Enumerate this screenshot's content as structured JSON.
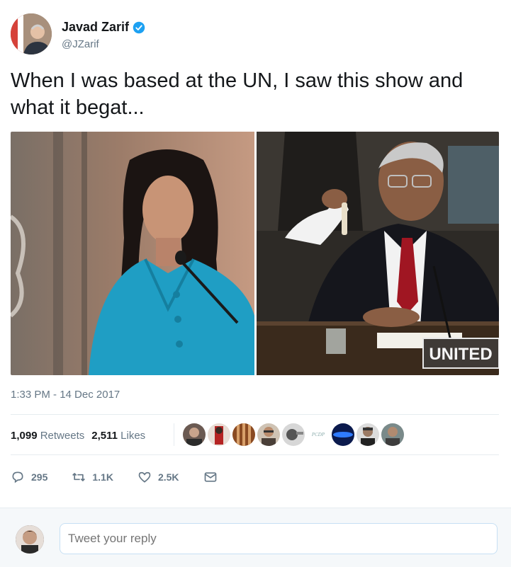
{
  "author": {
    "name": "Javad Zarif",
    "handle": "@JZarif",
    "verified": true
  },
  "tweet": {
    "text": "When I was based at the UN, I saw this show and what it begat...",
    "timestamp": "1:33 PM - 14 Dec 2017"
  },
  "media": {
    "right_sign_text": "UNITED"
  },
  "stats": {
    "retweets_count": "1,099",
    "retweets_label": "Retweets",
    "likes_count": "2,511",
    "likes_label": "Likes"
  },
  "actions": {
    "reply_count": "295",
    "retweet_count": "1.1K",
    "like_count": "2.5K"
  },
  "reply": {
    "placeholder": "Tweet your reply"
  },
  "colors": {
    "verified_blue": "#1da1f2",
    "text_secondary": "#657786"
  }
}
